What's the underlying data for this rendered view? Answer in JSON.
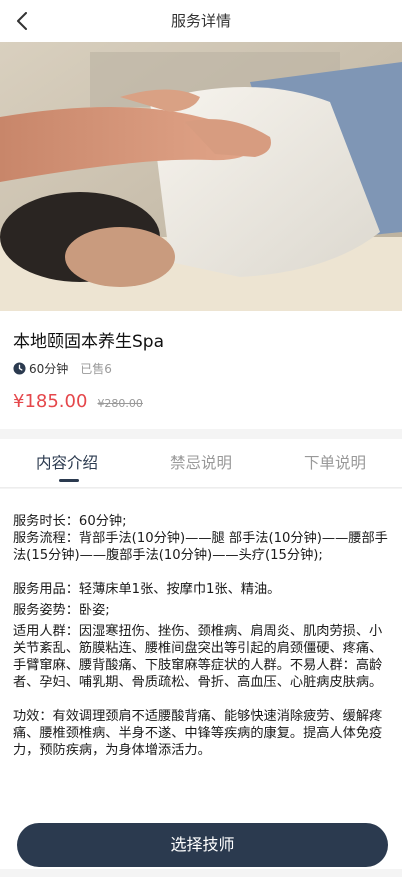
{
  "nav": {
    "title": "服务详情",
    "back_icon": "chevron-left-icon"
  },
  "hero": {
    "image": "spa-back-massage-photo"
  },
  "service": {
    "name": "本地颐固本养生Spa",
    "duration": "60分钟",
    "sold": "已售6",
    "price": "¥185.00",
    "original_price": "¥280.00",
    "price_color": "#e5474b"
  },
  "tabs": [
    {
      "label": "内容介绍",
      "active": true
    },
    {
      "label": "禁忌说明",
      "active": false
    },
    {
      "label": "下单说明",
      "active": false
    }
  ],
  "content": {
    "duration_line": "服务时长：60分钟;",
    "process_line": "服务流程：背部手法(10分钟)——腿 部手法(10分钟)——腰部手法(15分钟)——腹部手法(10分钟)——头疗(15分钟);",
    "supplies_line": "服务用品：轻薄床单1张、按摩巾1张、精油。",
    "posture_line": "服务姿势：卧姿;",
    "audience_line": "适用人群：因湿寒扭伤、挫伤、颈椎病、肩周炎、肌肉劳损、小关节紊乱、筋膜粘连、腰椎间盘突出等引起的肩颈僵硬、疼痛、手臂窜麻、腰背酸痛、下肢窜麻等症状的人群。不易人群：高龄者、孕妇、哺乳期、骨质疏松、骨折、高血压、心脏病皮肤病。",
    "effect_line": "功效：有效调理颈肩不适腰酸背痛、能够快速消除疲劳、缓解疼痛、腰椎颈椎病、半身不遂、中锋等疾病的康复。提高人体免疫力，预防疾病，为身体增添活力。"
  },
  "cta": {
    "label": "选择技师",
    "color": "#2b3a4f"
  }
}
